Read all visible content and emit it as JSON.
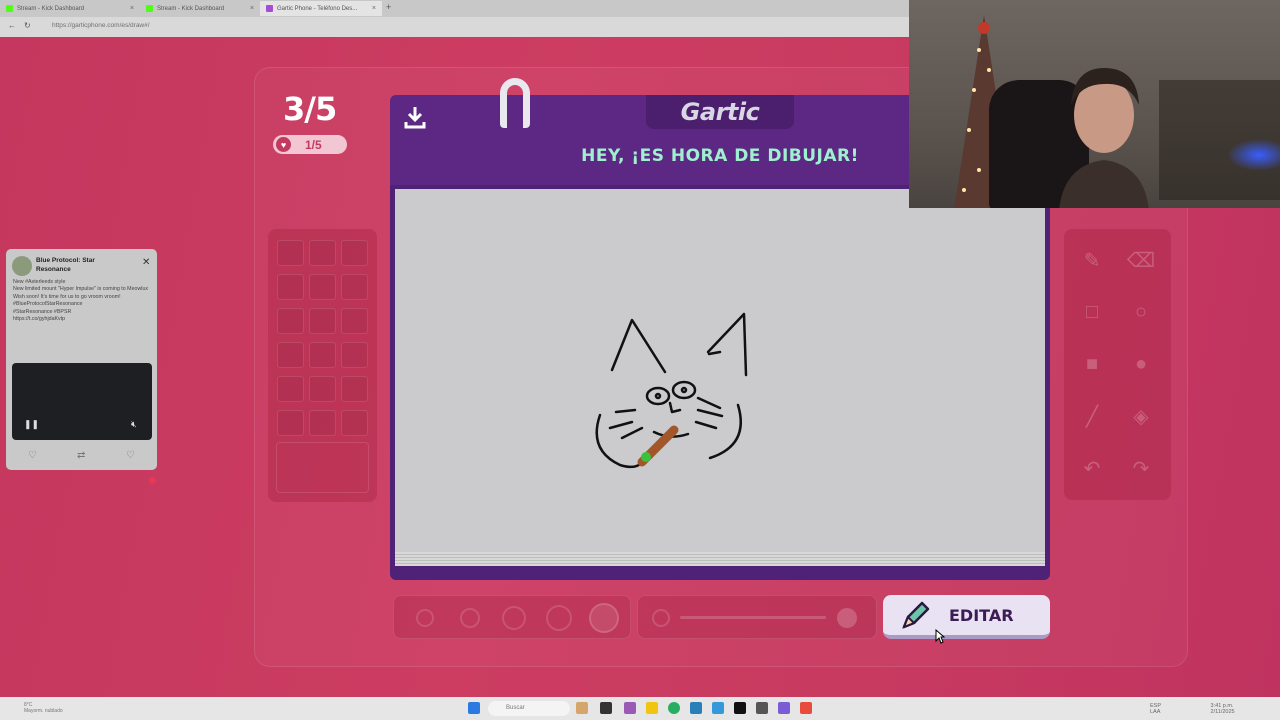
{
  "browser": {
    "tabs": [
      {
        "title": "Stream - Kick Dashboard",
        "active": false
      },
      {
        "title": "Stream - Kick Dashboard",
        "active": false
      },
      {
        "title": "Gartic Phone - Teléfono Des...",
        "active": true
      }
    ],
    "url": "https://garticphone.com/es/draw#/"
  },
  "game": {
    "round": "3/5",
    "lives": "1/5",
    "brand": "Gartic",
    "prompt": "HEY, ¡ES HORA DE DIBUJAR!",
    "edit_label": "EDITAR",
    "accent": "#5c2883",
    "prompt_color": "#9ff0cf"
  },
  "tools": [
    "pencil-icon",
    "eraser-icon",
    "square-outline-icon",
    "circle-outline-icon",
    "square-filled-icon",
    "circle-filled-icon",
    "line-icon",
    "fill-bucket-icon",
    "undo-icon",
    "redo-icon"
  ],
  "tweet": {
    "author": "Blue Protocol: Star Resonance",
    "body": "New #Asterleeds style\nNew limited mount \"Hyper Impulse\" is coming to Meowlux Wish soon! It's time for us to go vroom vroom!\n#BlueProtocolStarResonance\n#StarResonance #BPSR\nhttps://t.co/gyhjdaKvtp"
  },
  "taskbar": {
    "search_placeholder": "Buscar",
    "weather": "8°C\nMayorm. nublado",
    "tray_lang": "ESP\nLAA",
    "time": "3:41 p.m.\n2/11/2025"
  }
}
